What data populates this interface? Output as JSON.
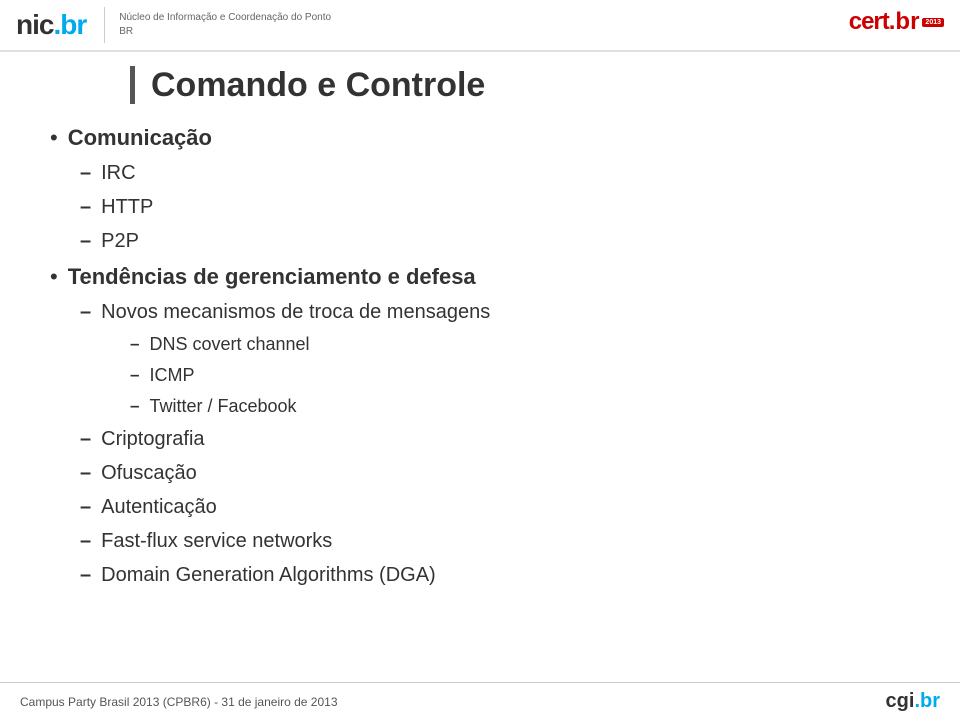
{
  "header": {
    "nic_logo": "nic.",
    "nic_br": "br",
    "tagline_line1": "Núcleo de Informação e Coordenação do Ponto BR",
    "cert_logo": "cert.",
    "cert_br": "br",
    "cert_badge": "2013"
  },
  "slide": {
    "title": "Comando e Controle",
    "items": [
      {
        "level": 1,
        "type": "dot",
        "text": "Comunicação"
      },
      {
        "level": 2,
        "type": "dash",
        "text": "IRC"
      },
      {
        "level": 2,
        "type": "dash",
        "text": "HTTP"
      },
      {
        "level": 2,
        "type": "dash",
        "text": "P2P"
      },
      {
        "level": 1,
        "type": "dot",
        "text": "Tendências de gerenciamento e defesa"
      },
      {
        "level": 2,
        "type": "dash",
        "text": "Novos mecanismos de troca de mensagens"
      },
      {
        "level": 3,
        "type": "dash",
        "text": "DNS covert channel"
      },
      {
        "level": 3,
        "type": "dash",
        "text": "ICMP"
      },
      {
        "level": 3,
        "type": "dash",
        "text": "Twitter / Facebook"
      },
      {
        "level": 2,
        "type": "dash",
        "text": "Criptografia"
      },
      {
        "level": 2,
        "type": "dash",
        "text": "Ofuscação"
      },
      {
        "level": 2,
        "type": "dash",
        "text": "Autenticação"
      },
      {
        "level": 2,
        "type": "dash",
        "text": "Fast-flux service networks"
      },
      {
        "level": 2,
        "type": "dash",
        "text": "Domain Generation Algorithms (DGA)"
      }
    ]
  },
  "footer": {
    "text": "Campus Party Brasil 2013 (CPBR6)  -  31 de janeiro de 2013",
    "logo": "cgi.",
    "logo_br": "br"
  }
}
